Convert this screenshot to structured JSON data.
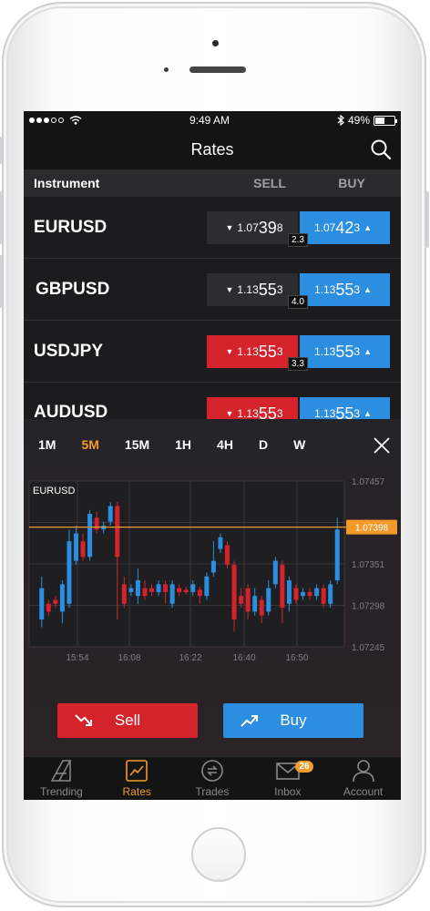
{
  "status_bar": {
    "time": "9:49 AM",
    "battery": "49%",
    "battery_level": 0.49
  },
  "header": {
    "title": "Rates"
  },
  "table": {
    "columns": {
      "instrument": "Instrument",
      "sell": "SELL",
      "buy": "BUY"
    },
    "rows": [
      {
        "instrument": "EURUSD",
        "sell_small": "1.07",
        "sell_big": "39",
        "sell_pip": "8",
        "buy_small": "1.07",
        "buy_big": "42",
        "buy_pip": "3",
        "spread": "2.3",
        "sell_style": "neutral"
      },
      {
        "instrument": "GBPUSD",
        "sell_small": "1.13",
        "sell_big": "55",
        "sell_pip": "3",
        "buy_small": "1.13",
        "buy_big": "55",
        "buy_pip": "3",
        "spread": "4.0",
        "sell_style": "neutral"
      },
      {
        "instrument": "USDJPY",
        "sell_small": "1.13",
        "sell_big": "55",
        "sell_pip": "3",
        "buy_small": "1.13",
        "buy_big": "55",
        "buy_pip": "3",
        "spread": "3.3",
        "sell_style": "red"
      },
      {
        "instrument": "AUDUSD",
        "sell_small": "1.13",
        "sell_big": "55",
        "sell_pip": "3",
        "buy_small": "1.13",
        "buy_big": "55",
        "buy_pip": "3",
        "spread": "",
        "sell_style": "red"
      }
    ]
  },
  "timeframes": [
    "1M",
    "5M",
    "15M",
    "1H",
    "4H",
    "D",
    "W"
  ],
  "active_timeframe": "5M",
  "chart_data": {
    "type": "candlestick",
    "title": "EURUSD",
    "x_ticks": [
      "15:54",
      "16:08",
      "16:22",
      "16:40",
      "16:50"
    ],
    "y_ticks": [
      "1.07457",
      "1.07404",
      "1.07351",
      "1.07298",
      "1.07245"
    ],
    "ylim": [
      1.07245,
      1.07457
    ],
    "current_price": "1.07398",
    "grid": true,
    "candles": [
      {
        "o": 1.0732,
        "c": 1.0728,
        "h": 1.07335,
        "l": 1.0727,
        "dir": "up"
      },
      {
        "o": 1.073,
        "c": 1.0729,
        "h": 1.07305,
        "l": 1.07285,
        "dir": "down"
      },
      {
        "o": 1.07305,
        "c": 1.073,
        "h": 1.0731,
        "l": 1.07295,
        "dir": "down"
      },
      {
        "o": 1.0729,
        "c": 1.07325,
        "h": 1.0733,
        "l": 1.07275,
        "dir": "up"
      },
      {
        "o": 1.073,
        "c": 1.0738,
        "h": 1.07395,
        "l": 1.07295,
        "dir": "up"
      },
      {
        "o": 1.07355,
        "c": 1.0739,
        "h": 1.074,
        "l": 1.0735,
        "dir": "up"
      },
      {
        "o": 1.0738,
        "c": 1.0736,
        "h": 1.0739,
        "l": 1.07355,
        "dir": "down"
      },
      {
        "o": 1.0736,
        "c": 1.07415,
        "h": 1.0742,
        "l": 1.07355,
        "dir": "up"
      },
      {
        "o": 1.0741,
        "c": 1.07395,
        "h": 1.07418,
        "l": 1.0739,
        "dir": "down"
      },
      {
        "o": 1.07395,
        "c": 1.074,
        "h": 1.07405,
        "l": 1.0739,
        "dir": "up"
      },
      {
        "o": 1.07405,
        "c": 1.07425,
        "h": 1.0743,
        "l": 1.074,
        "dir": "up"
      },
      {
        "o": 1.07425,
        "c": 1.0736,
        "h": 1.0743,
        "l": 1.0728,
        "dir": "down"
      },
      {
        "o": 1.07325,
        "c": 1.073,
        "h": 1.07335,
        "l": 1.07295,
        "dir": "down"
      },
      {
        "o": 1.07315,
        "c": 1.0732,
        "h": 1.07325,
        "l": 1.0731,
        "dir": "up"
      },
      {
        "o": 1.0731,
        "c": 1.0733,
        "h": 1.07345,
        "l": 1.073,
        "dir": "up"
      },
      {
        "o": 1.0732,
        "c": 1.0731,
        "h": 1.0733,
        "l": 1.07305,
        "dir": "down"
      },
      {
        "o": 1.0732,
        "c": 1.07315,
        "h": 1.07325,
        "l": 1.0731,
        "dir": "down"
      },
      {
        "o": 1.07315,
        "c": 1.07325,
        "h": 1.0733,
        "l": 1.0731,
        "dir": "up"
      },
      {
        "o": 1.07325,
        "c": 1.07315,
        "h": 1.0733,
        "l": 1.073,
        "dir": "down"
      },
      {
        "o": 1.073,
        "c": 1.07325,
        "h": 1.0733,
        "l": 1.07295,
        "dir": "up"
      },
      {
        "o": 1.0732,
        "c": 1.07315,
        "h": 1.07325,
        "l": 1.0731,
        "dir": "down"
      },
      {
        "o": 1.07318,
        "c": 1.07315,
        "h": 1.07322,
        "l": 1.07312,
        "dir": "down"
      },
      {
        "o": 1.07315,
        "c": 1.07325,
        "h": 1.0733,
        "l": 1.0731,
        "dir": "up"
      },
      {
        "o": 1.07318,
        "c": 1.0731,
        "h": 1.07322,
        "l": 1.073,
        "dir": "down"
      },
      {
        "o": 1.0731,
        "c": 1.07335,
        "h": 1.0734,
        "l": 1.07305,
        "dir": "up"
      },
      {
        "o": 1.0734,
        "c": 1.07355,
        "h": 1.0738,
        "l": 1.07335,
        "dir": "up"
      },
      {
        "o": 1.0737,
        "c": 1.07385,
        "h": 1.0739,
        "l": 1.07365,
        "dir": "up"
      },
      {
        "o": 1.07375,
        "c": 1.0735,
        "h": 1.0738,
        "l": 1.07345,
        "dir": "down"
      },
      {
        "o": 1.0735,
        "c": 1.0728,
        "h": 1.07355,
        "l": 1.07265,
        "dir": "down"
      },
      {
        "o": 1.0731,
        "c": 1.073,
        "h": 1.0732,
        "l": 1.07295,
        "dir": "down"
      },
      {
        "o": 1.0732,
        "c": 1.0729,
        "h": 1.07325,
        "l": 1.0728,
        "dir": "down"
      },
      {
        "o": 1.0729,
        "c": 1.0731,
        "h": 1.0732,
        "l": 1.07285,
        "dir": "up"
      },
      {
        "o": 1.07305,
        "c": 1.07285,
        "h": 1.0731,
        "l": 1.07275,
        "dir": "down"
      },
      {
        "o": 1.0729,
        "c": 1.0732,
        "h": 1.0733,
        "l": 1.07285,
        "dir": "up"
      },
      {
        "o": 1.07325,
        "c": 1.07355,
        "h": 1.0736,
        "l": 1.0732,
        "dir": "up"
      },
      {
        "o": 1.0735,
        "c": 1.07295,
        "h": 1.07355,
        "l": 1.07275,
        "dir": "down"
      },
      {
        "o": 1.073,
        "c": 1.0733,
        "h": 1.07335,
        "l": 1.0729,
        "dir": "up"
      },
      {
        "o": 1.0732,
        "c": 1.07305,
        "h": 1.07325,
        "l": 1.073,
        "dir": "down"
      },
      {
        "o": 1.0731,
        "c": 1.07315,
        "h": 1.0732,
        "l": 1.07305,
        "dir": "up"
      },
      {
        "o": 1.07315,
        "c": 1.0731,
        "h": 1.0732,
        "l": 1.07305,
        "dir": "down"
      },
      {
        "o": 1.0731,
        "c": 1.0732,
        "h": 1.07325,
        "l": 1.07305,
        "dir": "up"
      },
      {
        "o": 1.0732,
        "c": 1.073,
        "h": 1.07325,
        "l": 1.07295,
        "dir": "down"
      },
      {
        "o": 1.073,
        "c": 1.07325,
        "h": 1.0733,
        "l": 1.07295,
        "dir": "up"
      },
      {
        "o": 1.0733,
        "c": 1.07395,
        "h": 1.0741,
        "l": 1.07325,
        "dir": "up"
      }
    ]
  },
  "trade_buttons": {
    "sell": "Sell",
    "buy": "Buy"
  },
  "tabs": [
    {
      "label": "Trending",
      "icon": "trending-icon"
    },
    {
      "label": "Rates",
      "icon": "rates-icon",
      "active": true
    },
    {
      "label": "Trades",
      "icon": "trades-icon"
    },
    {
      "label": "Inbox",
      "icon": "inbox-icon",
      "badge": "26"
    },
    {
      "label": "Account",
      "icon": "account-icon"
    }
  ],
  "colors": {
    "accent": "#f39a2a",
    "sell": "#d4232b",
    "buy": "#2b8ee0"
  }
}
